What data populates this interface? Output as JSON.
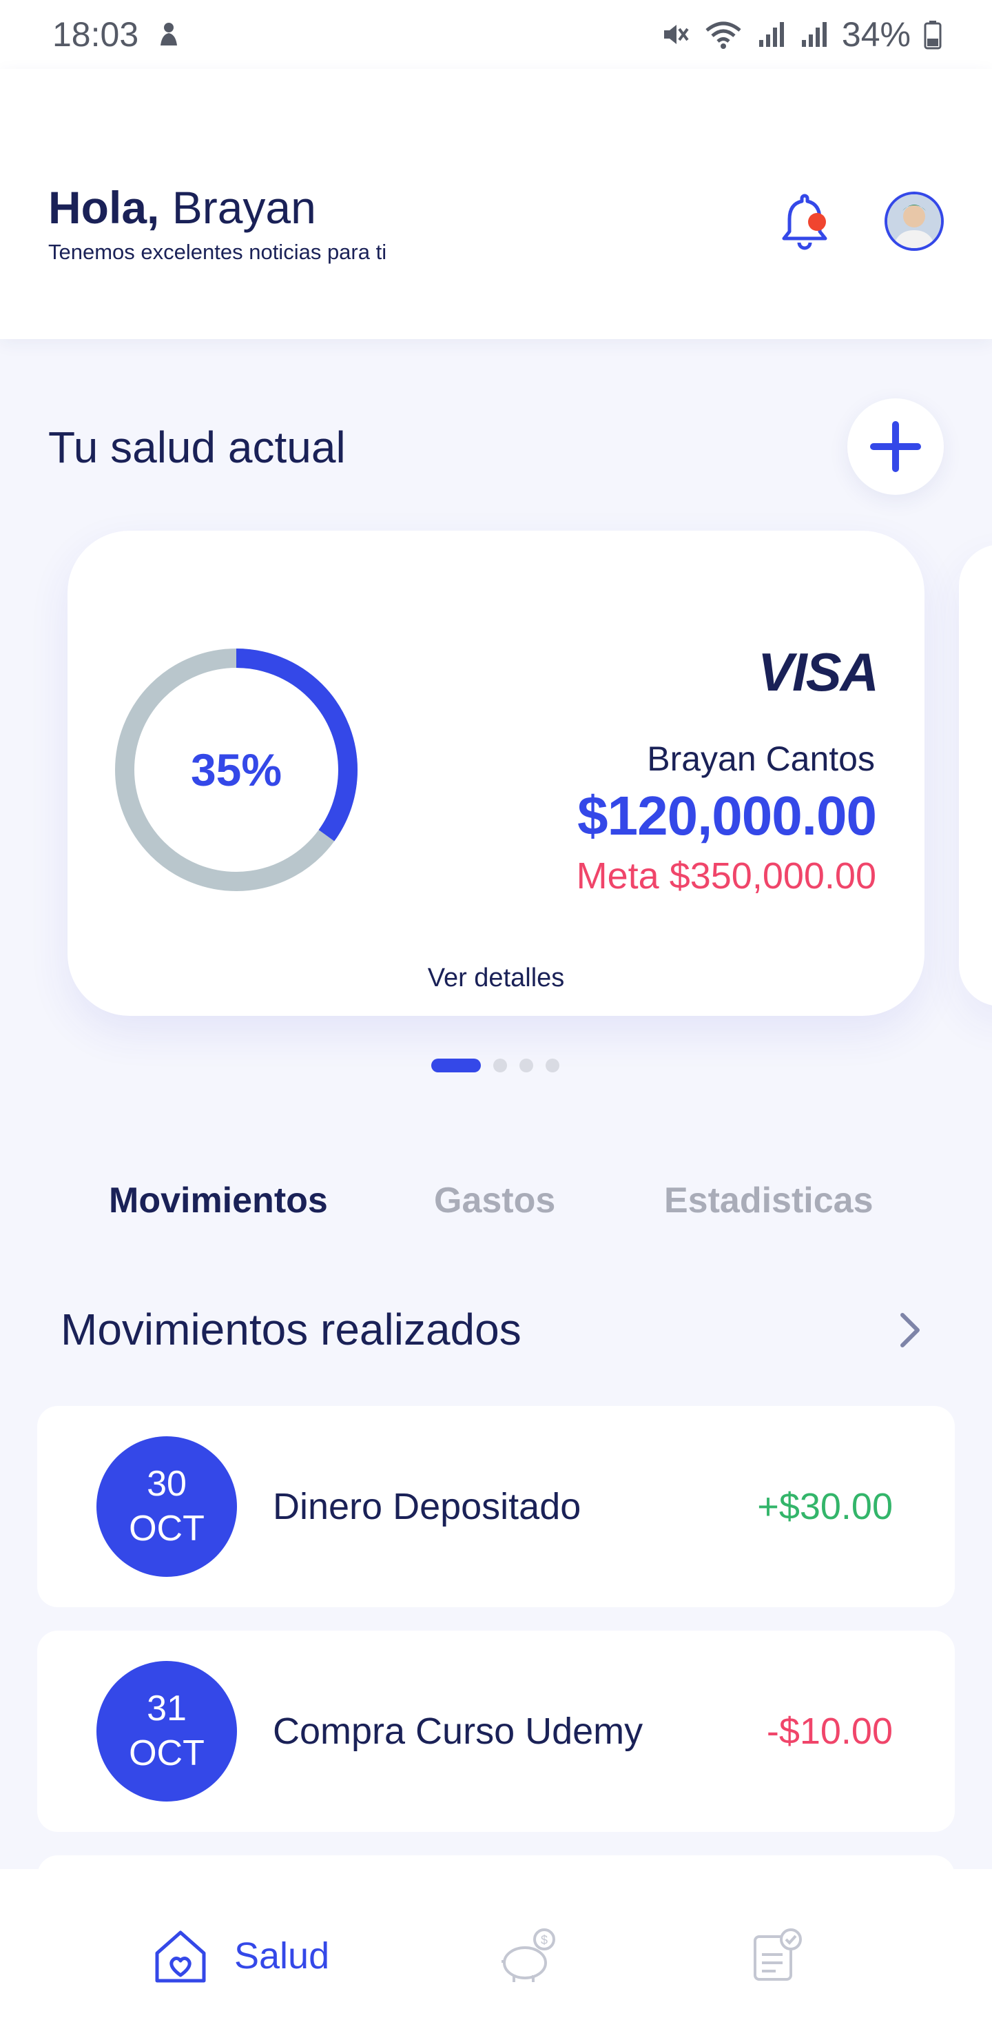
{
  "status_bar": {
    "time": "18:03",
    "battery": "34%",
    "icons": [
      "notification-icon",
      "mute-icon",
      "wifi-icon",
      "signal-icon",
      "signal-icon",
      "battery-icon"
    ]
  },
  "header": {
    "hello": "Hola,",
    "name": "Brayan",
    "subtitle": "Tenemos excelentes noticias para ti"
  },
  "health": {
    "title": "Tu salud actual",
    "card": {
      "progress_label": "35%",
      "progress": 0.35,
      "brand": "VISA",
      "holder": "Brayan Cantos",
      "amount": "$120,000.00",
      "goal": "Meta $350,000.00",
      "details": "Ver detalles"
    },
    "pager": {
      "pages": 4,
      "active": 1
    }
  },
  "tabs": [
    {
      "label": "Movimientos",
      "active": true
    },
    {
      "label": "Gastos",
      "active": false
    },
    {
      "label": "Estadisticas",
      "active": false
    }
  ],
  "movements": {
    "title": "Movimientos realizados",
    "items": [
      {
        "day": "30",
        "month": "OCT",
        "label": "Dinero Depositado",
        "amount": "+$30.00",
        "type": "positive"
      },
      {
        "day": "31",
        "month": "OCT",
        "label": "Compra Curso Udemy",
        "amount": "-$10.00",
        "type": "negative"
      }
    ]
  },
  "bottom_nav": {
    "items": [
      {
        "label": "Salud",
        "icon": "home-heart-icon",
        "active": true
      },
      {
        "label": "",
        "icon": "piggy-bank-icon",
        "active": false
      },
      {
        "label": "",
        "icon": "checklist-icon",
        "active": false
      }
    ]
  },
  "colors": {
    "primary": "#3448e8",
    "navy": "#1a2157",
    "positive": "#33b56a",
    "negative": "#f0456a",
    "ring_track": "#b9c6cc",
    "background": "#f5f6fd"
  }
}
